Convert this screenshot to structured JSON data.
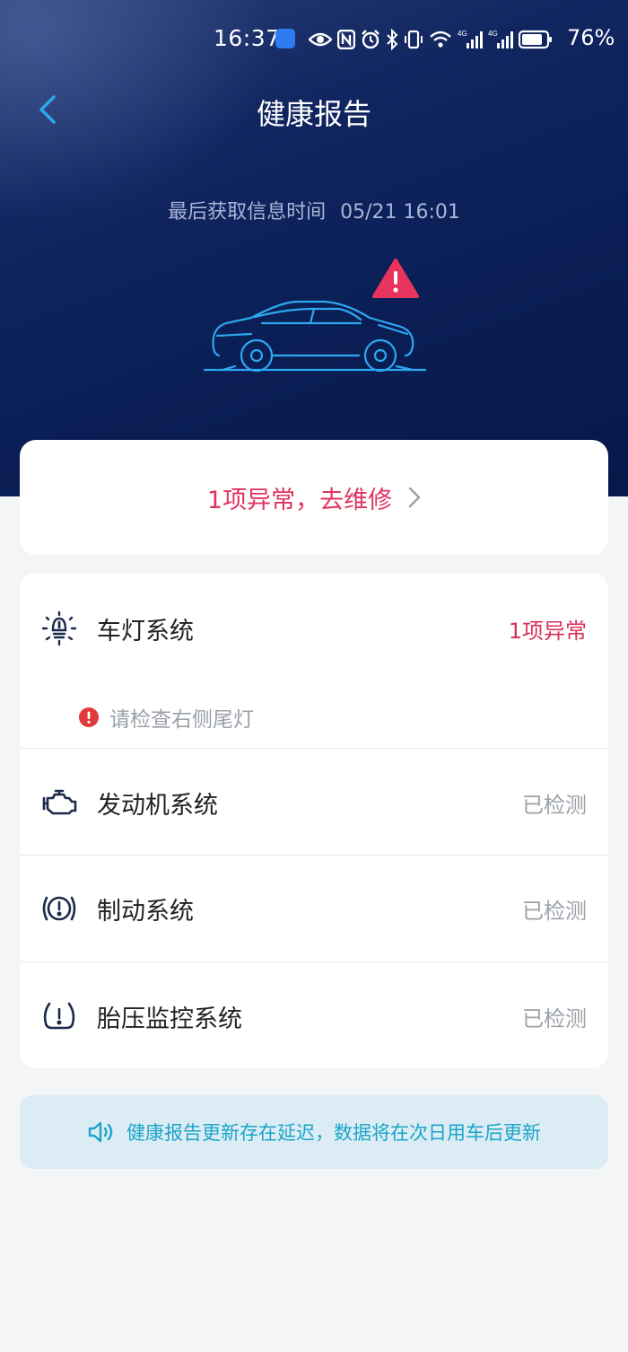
{
  "status_bar": {
    "time": "16:37",
    "battery": "76%",
    "icons": [
      "app-badge-icon",
      "eye-icon",
      "nfc-icon",
      "alarm-icon",
      "bluetooth-icon",
      "vibrate-icon",
      "wifi-icon",
      "signal-4g-icon",
      "signal-4g-icon",
      "battery-icon"
    ]
  },
  "header": {
    "title": "健康报告",
    "back_icon": "chevron-left-icon"
  },
  "info": {
    "label": "最后获取信息时间",
    "time": "05/21 16:01"
  },
  "repair": {
    "text": "1项异常，去维修"
  },
  "systems": [
    {
      "name": "车灯系统",
      "status": "1项异常",
      "icon": "headlight-icon",
      "alert": true,
      "detail": "请检查右侧尾灯"
    },
    {
      "name": "发动机系统",
      "status": "已检测",
      "icon": "engine-icon",
      "alert": false
    },
    {
      "name": "制动系统",
      "status": "已检测",
      "icon": "brake-icon",
      "alert": false
    },
    {
      "name": "胎压监控系统",
      "status": "已检测",
      "icon": "tire-pressure-icon",
      "alert": false
    }
  ],
  "notice": {
    "text": "健康报告更新存在延迟，数据将在次日用车后更新",
    "icon": "speaker-icon"
  },
  "colors": {
    "accent": "#2aa8e8",
    "alert": "#e0335d",
    "hero_bg": "#0a1f56",
    "notice_bg": "#dcecf4",
    "notice_text": "#1aa5c9"
  }
}
